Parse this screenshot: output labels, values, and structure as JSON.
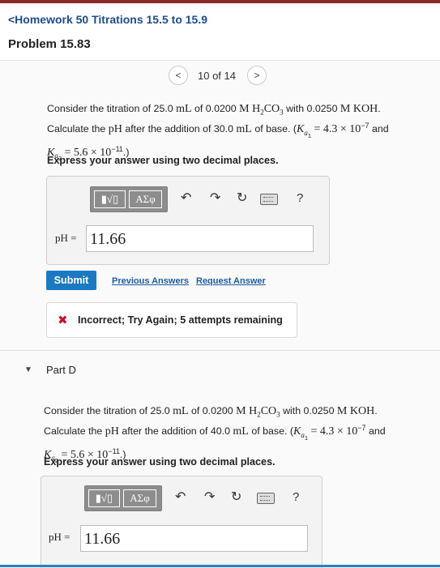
{
  "header": {
    "back_link": "<Homework 50 Titrations 15.5 to 15.9",
    "problem_title": "Problem 15.83"
  },
  "pager": {
    "prev": "<",
    "text": "10 of 14",
    "next": ">"
  },
  "part_c": {
    "q_line1_a": "Consider the titration of 25.0 ",
    "q_line1_b": "mL",
    "q_line1_c": " of 0.0200 ",
    "q_line1_d": "M H",
    "q_line1_e": "2",
    "q_line1_f": "CO",
    "q_line1_g": "3",
    "q_line1_h": " with 0.0250 ",
    "q_line1_i": "M KOH",
    "q_line1_j": ".",
    "q_line2_a": "Calculate the ",
    "q_line2_b": "pH",
    "q_line2_c": " after the addition of 30.0 ",
    "q_line2_d": "mL",
    "q_line2_e": " of base. (",
    "q_line2_f": "K",
    "q_line2_g": "a",
    "q_line2_h": "1",
    "q_line2_i": " = 4.3 × 10",
    "q_line2_j": "−7",
    "q_line2_k": " and",
    "q_line3_a": "K",
    "q_line3_b": "a",
    "q_line3_c": "2",
    "q_line3_d": " = 5.6 × 10",
    "q_line3_e": "−11",
    "q_line3_f": ".)",
    "instruction": "Express your answer using two decimal places.",
    "toolbar": {
      "sqrt_label": "▮√▯",
      "greek_label": "ΑΣφ",
      "undo_symbol": "↶",
      "redo_symbol": "↷",
      "reset_symbol": "↻",
      "help_symbol": "?"
    },
    "ph_label": "pH =",
    "ph_value": "11.66",
    "submit": "Submit",
    "previous_answers": "Previous Answers",
    "request_answer": "Request Answer",
    "feedback_icon": "✖",
    "feedback": "Incorrect; Try Again; 5 attempts remaining"
  },
  "part_d": {
    "caret": "▼",
    "title": "Part D",
    "q_line1_a": "Consider the titration of 25.0 ",
    "q_line1_b": "mL",
    "q_line1_c": " of 0.0200 ",
    "q_line1_d": "M H",
    "q_line1_e": "2",
    "q_line1_f": "CO",
    "q_line1_g": "3",
    "q_line1_h": " with 0.0250 ",
    "q_line1_i": "M KOH",
    "q_line1_j": ".",
    "q_line2_a": "Calculate the ",
    "q_line2_b": "pH",
    "q_line2_c": " after the addition of 40.0 ",
    "q_line2_d": "mL",
    "q_line2_e": " of base. (",
    "q_line2_f": "K",
    "q_line2_g": "a",
    "q_line2_h": "1",
    "q_line2_i": " = 4.3 × 10",
    "q_line2_j": "−7",
    "q_line2_k": " and",
    "q_line3_a": "K",
    "q_line3_b": "a",
    "q_line3_c": "2",
    "q_line3_d": " = 5.6 × 10",
    "q_line3_e": "−11",
    "q_line3_f": ".)",
    "instruction": "Express your answer using two decimal places.",
    "toolbar": {
      "sqrt_label": "▮√▯",
      "greek_label": "ΑΣφ",
      "undo_symbol": "↶",
      "redo_symbol": "↷",
      "reset_symbol": "↻",
      "help_symbol": "?"
    },
    "ph_label": "pH =",
    "ph_value": "11.66"
  },
  "colors": {
    "submit_bg": "#1b79c2",
    "link": "#1b5ba3",
    "error": "#c8102e",
    "toolbar_bg": "#8d8d8d"
  }
}
